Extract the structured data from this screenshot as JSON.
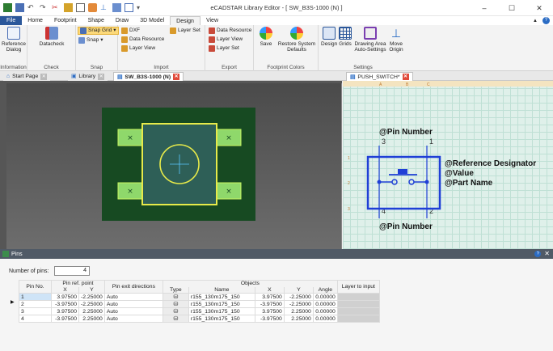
{
  "window": {
    "title": "eCADSTAR Library Editor - [ SW_B3S-1000 (N) ]",
    "controls": [
      "–",
      "☐",
      "✕"
    ]
  },
  "ribbon_tabs": [
    "File",
    "Home",
    "Footprint",
    "Shape",
    "Draw",
    "3D Model",
    "Design",
    "View"
  ],
  "active_tab": "Design",
  "ribbon": {
    "information": {
      "label": "Information",
      "reference_dialog": "Reference Dialog"
    },
    "check": {
      "label": "Check",
      "datacheck": "Datacheck"
    },
    "snap": {
      "label": "Snap",
      "snap_grid": "Snap Grid",
      "snap": "Snap"
    },
    "import": {
      "label": "Import",
      "dxf": "DXF",
      "data_resource": "Data Resource",
      "layer_view": "Layer View",
      "layer_set": "Layer Set"
    },
    "export": {
      "label": "Export",
      "data_resource": "Data Resource",
      "layer_view": "Layer View",
      "layer_set": "Layer Set"
    },
    "footprint_colors": {
      "label": "Footprint Colors",
      "save": "Save",
      "restore": "Restore System Defaults"
    },
    "settings": {
      "label": "Settings",
      "design": "Design",
      "grids": "Grids",
      "drawing_area": "Drawing Area Auto-Settings",
      "move_origin": "Move Origin"
    }
  },
  "doc_tabs": [
    {
      "label": "Start Page"
    },
    {
      "label": "Library"
    },
    {
      "label": "SW_B3S-1000 (N)"
    },
    {
      "label": "PUSH_SWITCH*"
    }
  ],
  "symbol": {
    "pin_number_top": "@Pin Number",
    "pin_number_bottom": "@Pin Number",
    "ref_designator": "@Reference Designator",
    "value": "@Value",
    "part_name": "@Part Name",
    "pins": [
      "3",
      "1",
      "4",
      "2"
    ],
    "ruler_letters": [
      "A",
      "B",
      "C"
    ],
    "ruler_numbers": [
      "1",
      "2",
      "3"
    ]
  },
  "pads": [
    "×",
    "×",
    "×",
    "×"
  ],
  "pins_panel": {
    "title": "Pins",
    "number_of_pins_label": "Number of pins:",
    "number_of_pins": "4",
    "headers": {
      "pin_no": "Pin No.",
      "ref_point": "Pin ref. point",
      "x": "X",
      "y": "Y",
      "exit": "Pin exit directions",
      "type": "Type",
      "name": "Name",
      "objects": "Objects",
      "ox": "X",
      "oy": "Y",
      "angle": "Angle",
      "layer": "Layer to input"
    },
    "rows": [
      {
        "no": "1",
        "x": "3.97500",
        "y": "-2.25000",
        "exit": "Auto",
        "name": "r155_130m175_150",
        "ox": "3.97500",
        "oy": "-2.25000",
        "angle": "0.00000"
      },
      {
        "no": "2",
        "x": "-3.97500",
        "y": "-2.25000",
        "exit": "Auto",
        "name": "r155_130m175_150",
        "ox": "-3.97500",
        "oy": "-2.25000",
        "angle": "0.00000"
      },
      {
        "no": "3",
        "x": "3.97500",
        "y": "2.25000",
        "exit": "Auto",
        "name": "r155_130m175_150",
        "ox": "3.97500",
        "oy": "2.25000",
        "angle": "0.00000"
      },
      {
        "no": "4",
        "x": "-3.97500",
        "y": "2.25000",
        "exit": "Auto",
        "name": "r155_130m175_150",
        "ox": "-3.97500",
        "oy": "2.25000",
        "angle": "0.00000"
      }
    ]
  },
  "colors": {
    "board": "#174a22",
    "pad": "#8fd86b",
    "pad_stroke": "#c8f560",
    "body": "#2e5f57",
    "body_stroke": "#e7ea4a",
    "symbol_blue": "#1f3fd6",
    "accent": "#2b579a"
  }
}
